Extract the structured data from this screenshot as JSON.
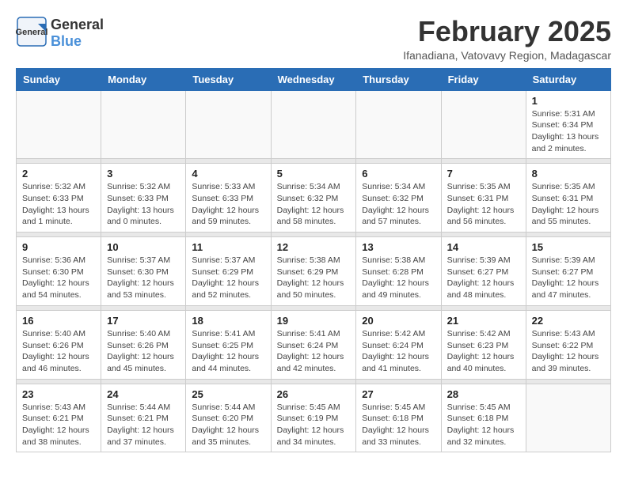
{
  "logo": {
    "general": "General",
    "blue": "Blue"
  },
  "title": "February 2025",
  "subtitle": "Ifanadiana, Vatovavy Region, Madagascar",
  "weekdays": [
    "Sunday",
    "Monday",
    "Tuesday",
    "Wednesday",
    "Thursday",
    "Friday",
    "Saturday"
  ],
  "weeks": [
    [
      {
        "day": "",
        "info": ""
      },
      {
        "day": "",
        "info": ""
      },
      {
        "day": "",
        "info": ""
      },
      {
        "day": "",
        "info": ""
      },
      {
        "day": "",
        "info": ""
      },
      {
        "day": "",
        "info": ""
      },
      {
        "day": "1",
        "info": "Sunrise: 5:31 AM\nSunset: 6:34 PM\nDaylight: 13 hours\nand 2 minutes."
      }
    ],
    [
      {
        "day": "2",
        "info": "Sunrise: 5:32 AM\nSunset: 6:33 PM\nDaylight: 13 hours\nand 1 minute."
      },
      {
        "day": "3",
        "info": "Sunrise: 5:32 AM\nSunset: 6:33 PM\nDaylight: 13 hours\nand 0 minutes."
      },
      {
        "day": "4",
        "info": "Sunrise: 5:33 AM\nSunset: 6:33 PM\nDaylight: 12 hours\nand 59 minutes."
      },
      {
        "day": "5",
        "info": "Sunrise: 5:34 AM\nSunset: 6:32 PM\nDaylight: 12 hours\nand 58 minutes."
      },
      {
        "day": "6",
        "info": "Sunrise: 5:34 AM\nSunset: 6:32 PM\nDaylight: 12 hours\nand 57 minutes."
      },
      {
        "day": "7",
        "info": "Sunrise: 5:35 AM\nSunset: 6:31 PM\nDaylight: 12 hours\nand 56 minutes."
      },
      {
        "day": "8",
        "info": "Sunrise: 5:35 AM\nSunset: 6:31 PM\nDaylight: 12 hours\nand 55 minutes."
      }
    ],
    [
      {
        "day": "9",
        "info": "Sunrise: 5:36 AM\nSunset: 6:30 PM\nDaylight: 12 hours\nand 54 minutes."
      },
      {
        "day": "10",
        "info": "Sunrise: 5:37 AM\nSunset: 6:30 PM\nDaylight: 12 hours\nand 53 minutes."
      },
      {
        "day": "11",
        "info": "Sunrise: 5:37 AM\nSunset: 6:29 PM\nDaylight: 12 hours\nand 52 minutes."
      },
      {
        "day": "12",
        "info": "Sunrise: 5:38 AM\nSunset: 6:29 PM\nDaylight: 12 hours\nand 50 minutes."
      },
      {
        "day": "13",
        "info": "Sunrise: 5:38 AM\nSunset: 6:28 PM\nDaylight: 12 hours\nand 49 minutes."
      },
      {
        "day": "14",
        "info": "Sunrise: 5:39 AM\nSunset: 6:27 PM\nDaylight: 12 hours\nand 48 minutes."
      },
      {
        "day": "15",
        "info": "Sunrise: 5:39 AM\nSunset: 6:27 PM\nDaylight: 12 hours\nand 47 minutes."
      }
    ],
    [
      {
        "day": "16",
        "info": "Sunrise: 5:40 AM\nSunset: 6:26 PM\nDaylight: 12 hours\nand 46 minutes."
      },
      {
        "day": "17",
        "info": "Sunrise: 5:40 AM\nSunset: 6:26 PM\nDaylight: 12 hours\nand 45 minutes."
      },
      {
        "day": "18",
        "info": "Sunrise: 5:41 AM\nSunset: 6:25 PM\nDaylight: 12 hours\nand 44 minutes."
      },
      {
        "day": "19",
        "info": "Sunrise: 5:41 AM\nSunset: 6:24 PM\nDaylight: 12 hours\nand 42 minutes."
      },
      {
        "day": "20",
        "info": "Sunrise: 5:42 AM\nSunset: 6:24 PM\nDaylight: 12 hours\nand 41 minutes."
      },
      {
        "day": "21",
        "info": "Sunrise: 5:42 AM\nSunset: 6:23 PM\nDaylight: 12 hours\nand 40 minutes."
      },
      {
        "day": "22",
        "info": "Sunrise: 5:43 AM\nSunset: 6:22 PM\nDaylight: 12 hours\nand 39 minutes."
      }
    ],
    [
      {
        "day": "23",
        "info": "Sunrise: 5:43 AM\nSunset: 6:21 PM\nDaylight: 12 hours\nand 38 minutes."
      },
      {
        "day": "24",
        "info": "Sunrise: 5:44 AM\nSunset: 6:21 PM\nDaylight: 12 hours\nand 37 minutes."
      },
      {
        "day": "25",
        "info": "Sunrise: 5:44 AM\nSunset: 6:20 PM\nDaylight: 12 hours\nand 35 minutes."
      },
      {
        "day": "26",
        "info": "Sunrise: 5:45 AM\nSunset: 6:19 PM\nDaylight: 12 hours\nand 34 minutes."
      },
      {
        "day": "27",
        "info": "Sunrise: 5:45 AM\nSunset: 6:18 PM\nDaylight: 12 hours\nand 33 minutes."
      },
      {
        "day": "28",
        "info": "Sunrise: 5:45 AM\nSunset: 6:18 PM\nDaylight: 12 hours\nand 32 minutes."
      },
      {
        "day": "",
        "info": ""
      }
    ]
  ]
}
